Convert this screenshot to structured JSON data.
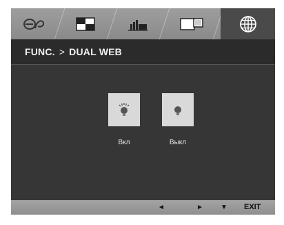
{
  "tabs": [
    {
      "icon": "picture-mode-icon",
      "active": false
    },
    {
      "icon": "screen-split-icon",
      "active": false
    },
    {
      "icon": "brightness-level-icon",
      "active": false
    },
    {
      "icon": "dual-display-icon",
      "active": false
    },
    {
      "icon": "globe-icon",
      "active": true
    }
  ],
  "breadcrumb": {
    "parent": "FUNC.",
    "separator": ">",
    "current": "DUAL WEB"
  },
  "options": [
    {
      "label": "Вкл",
      "icon": "bulb-on-icon"
    },
    {
      "label": "Выкл",
      "icon": "bulb-off-icon"
    }
  ],
  "bottom_bar": {
    "left_symbol": "◄",
    "right_symbol": "►",
    "down_symbol": "▼",
    "exit_label": "EXIT"
  },
  "colors": {
    "background": "#363636",
    "tabbar": "#9a9a9a",
    "option_tile": "#d9d9d9"
  }
}
